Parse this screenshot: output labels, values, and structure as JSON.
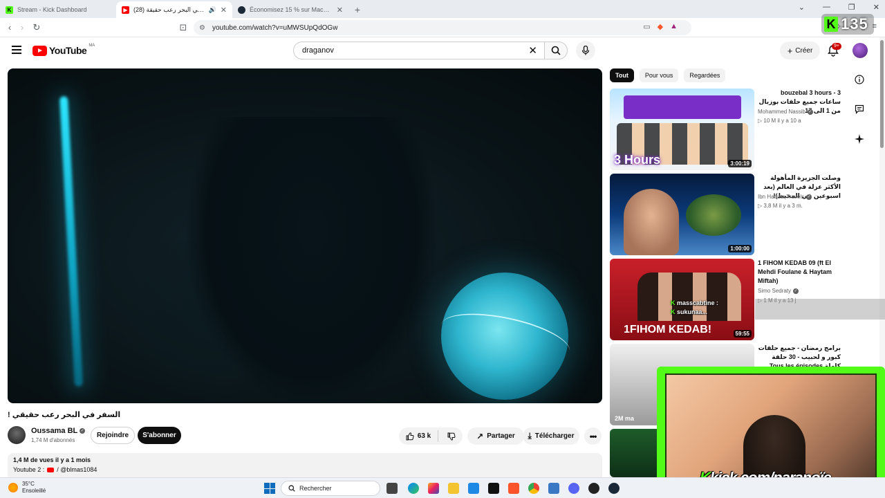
{
  "browser": {
    "tabs": [
      {
        "title": "Stream - Kick Dashboard",
        "active": false
      },
      {
        "title": "(28) السفر في البحر رعب حقيقة...",
        "active": true
      },
      {
        "title": "Économisez 15 % sur Machine Party",
        "active": false
      }
    ],
    "url": "youtube.com/watch?v=uMWSUpQdOGw"
  },
  "kick_badge": {
    "count": "135"
  },
  "youtube": {
    "logo_text": "YouTube",
    "region": "MA",
    "search_value": "draganov",
    "create_label": "Créer",
    "notif_count": "9+"
  },
  "video": {
    "title": "السفر في البحر رعب حقيقي !",
    "channel": "Oussama BL",
    "subscribers": "1,74 M d'abonnés",
    "join_label": "Rejoindre",
    "subscribe_label": "S'abonner",
    "likes": "63 k",
    "share_label": "Partager",
    "download_label": "Télécharger",
    "stats": "1,4 M de vues  il y a 1 mois",
    "desc_prefix": "Youtube 2 :",
    "desc_handle": "/ @blmas1084"
  },
  "sidebar": {
    "chips": [
      {
        "label": "Tout",
        "active": true
      },
      {
        "label": "Pour vous",
        "active": false
      },
      {
        "label": "Regardées",
        "active": false
      }
    ],
    "videos": [
      {
        "title": "bouzebal 3 hours - 3 ساعات جميع حلقات بوزبال من 1 الى 17",
        "channel": "Mohammed Nassib",
        "meta": "▷ 10 M   il y a 10 a",
        "duration": "3:00:19",
        "thumb_text": "3 Hours"
      },
      {
        "title": "وصلت الجزيرة المأهولة الأكثر عزلة في العالم (بعد اسبوعين في المحيط)!",
        "channel": "Ibn Hattuta Travels",
        "meta": "▷ 3,8 M   il y a 3 m.",
        "duration": "1:00:00"
      },
      {
        "title": "1 FIHOM KEDAB 09 (ft El Mehdi Foulane & Haytam Miftah)",
        "channel": "Simo Sedraty",
        "meta": "▷ 1 M   il y a 13 j",
        "duration": "59:55",
        "thumb_text": "1FIHOM KEDAB!"
      },
      {
        "title": "برامج رمضان - جميع حلقات كبور و لحبيب - 30 حلقة كاملة Tous les épisodes",
        "channel": "",
        "meta": "",
        "duration": "",
        "thumb_text": "2M ma"
      }
    ]
  },
  "stream_overlay": {
    "url_k": "K",
    "url_text": "kick.com/paranoïe",
    "chat_user1": "masscabtine :",
    "chat_user2": "sukunaa..."
  },
  "taskbar": {
    "temp": "35°C",
    "weather": "Ensoleillé",
    "search_label": "Rechercher"
  }
}
